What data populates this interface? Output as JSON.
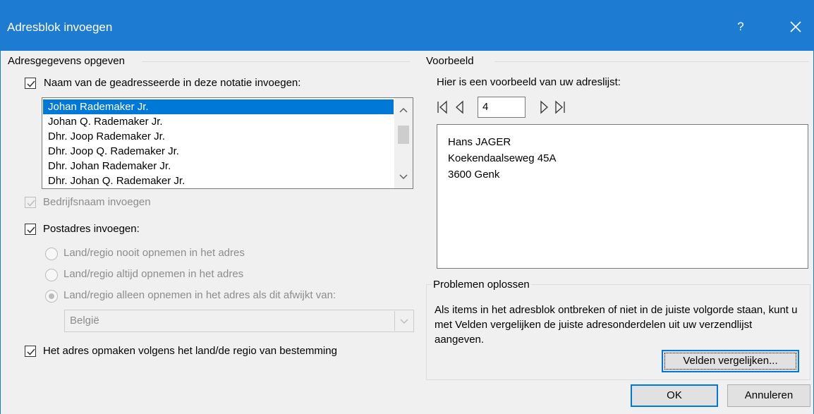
{
  "window": {
    "title": "Adresblok invoegen",
    "help_label": "?",
    "close_label": "✕",
    "accent_color": "#1e7bd2"
  },
  "left": {
    "group_title": "Adresgegevens opgeven",
    "name_format_checkbox": {
      "label": "Naam van de geadresseerde in deze notatie invoegen:",
      "checked": true
    },
    "name_formats": [
      "Johan Rademaker Jr.",
      "Johan Q. Rademaker Jr.",
      "Dhr. Joop Rademaker Jr.",
      "Dhr. Joop Q. Rademaker Jr.",
      "Dhr. Johan Rademaker Jr.",
      "Dhr. Johan Q. Rademaker Jr."
    ],
    "selected_name_format": "Johan Rademaker Jr.",
    "company_checkbox": {
      "label": "Bedrijfsnaam invoegen",
      "checked": true,
      "enabled": false
    },
    "postal_checkbox": {
      "label": "Postadres invoegen:",
      "checked": true
    },
    "country_options": [
      {
        "label": "Land/regio nooit opnemen in het adres",
        "selected": false
      },
      {
        "label": "Land/regio altijd opnemen in het adres",
        "selected": false
      },
      {
        "label": "Land/regio alleen opnemen in het adres als dit afwijkt van:",
        "selected": true
      }
    ],
    "country_select_value": "België",
    "format_checkbox": {
      "label": "Het adres opmaken volgens het land/de regio van bestemming",
      "checked": true
    }
  },
  "right": {
    "group_title": "Voorbeeld",
    "preview_caption": "Hier is een voorbeeld van uw adreslijst:",
    "record_number": "4",
    "preview_lines": [
      "Hans JAGER",
      "Koekendaalseweg 45A",
      "3600 Genk"
    ],
    "trouble_title": "Problemen oplossen",
    "trouble_text": "Als items in het adresblok ontbreken of niet in de juiste volgorde staan, kunt u met Velden vergelijken de juiste adresonderdelen uit uw verzendlijst aangeven.",
    "match_fields_label": "Velden vergelijken..."
  },
  "footer": {
    "ok_label": "OK",
    "cancel_label": "Annuleren"
  }
}
